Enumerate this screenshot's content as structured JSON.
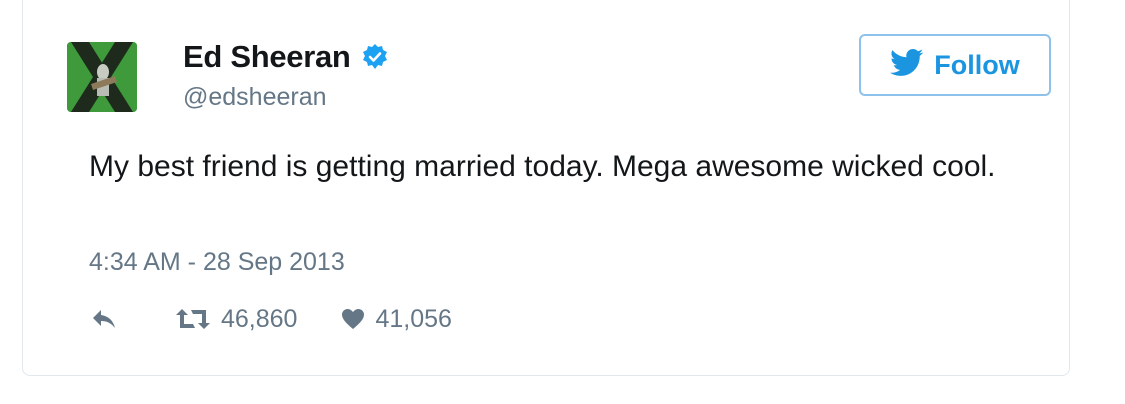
{
  "tweet": {
    "display_name": "Ed Sheeran",
    "handle": "@edsheeran",
    "verified": true,
    "text": "My best friend is getting married today. Mega awesome wicked cool.",
    "timestamp": "4:34 AM - 28 Sep 2013",
    "retweets": "46,860",
    "likes": "41,056"
  },
  "follow_button": {
    "label": "Follow"
  },
  "colors": {
    "accent": "#1b95e0",
    "follow_border": "#8ec2ea",
    "verified_badge": "#1da1f2",
    "text_primary": "#14171a",
    "text_secondary": "#657786",
    "avatar_green": "#3d8f3a"
  },
  "icons": {
    "verified": "verified-badge-icon",
    "follow": "twitter-bird-icon",
    "reply": "reply-arrow-icon",
    "retweet": "retweet-icon",
    "like": "heart-icon"
  }
}
